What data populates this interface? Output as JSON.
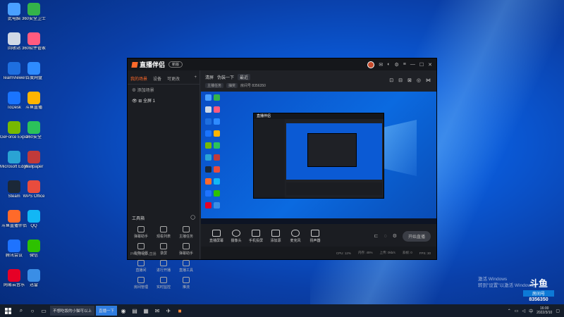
{
  "desktop_icons": [
    {
      "label": "此电脑",
      "color": "#4aa0ff"
    },
    {
      "label": "360安全卫士",
      "color": "#34b34a"
    },
    {
      "label": "回收站",
      "color": "#cfd8e6"
    },
    {
      "label": "360软件管家",
      "color": "#ff5b7f"
    },
    {
      "label": "TeamViewer",
      "color": "#1e6fe0"
    },
    {
      "label": "百度网盘",
      "color": "#2e8bff"
    },
    {
      "label": "ToDesk",
      "color": "#1a74ff"
    },
    {
      "label": "斗鱼直播",
      "color": "#ffb400"
    },
    {
      "label": "GeForce Experience",
      "color": "#76b900"
    },
    {
      "label": "360安全",
      "color": "#2bc25b"
    },
    {
      "label": "Microsoft Edge",
      "color": "#2aa3d4"
    },
    {
      "label": "Wallpaper",
      "color": "#c03a3a"
    },
    {
      "label": "Steam",
      "color": "#1b2838"
    },
    {
      "label": "WPS Office",
      "color": "#e84c3d"
    },
    {
      "label": "斗鱼直播伴侣",
      "color": "#ff6a2a"
    },
    {
      "label": "QQ",
      "color": "#12b7f5"
    },
    {
      "label": "腾讯会议",
      "color": "#1e73ff"
    },
    {
      "label": "微信",
      "color": "#2dc100"
    },
    {
      "label": "网易云音乐",
      "color": "#e60026"
    },
    {
      "label": "迅雷",
      "color": "#3a8ee6"
    }
  ],
  "app": {
    "title": "直播伴侣",
    "version_badge": "新版",
    "sidebar_tabs": [
      "我的场景",
      "设备",
      "可更改"
    ],
    "add_label": "+",
    "scene_add_label": "添加场景",
    "scene_name": "全屏 1",
    "tools_header": "工具箱",
    "tools": [
      "弹幕助手",
      "观看列表",
      "主播任务",
      "礼物设置",
      "录屏",
      "弹幕助手",
      "直播间",
      "进行开播",
      "直播工具",
      "房间管理",
      "实时监控",
      "推流"
    ],
    "status_left": "PK助手进入直播",
    "head_row1": [
      "清屏",
      "伪装一下",
      "最近"
    ],
    "head_row2": [
      "主播任务",
      "抽奖"
    ],
    "room_label": "房间号 8356350",
    "controls": [
      "直播屏幕",
      "摄像头",
      "手机投屏",
      "添加源",
      "麦克风",
      "扬声器"
    ],
    "start_button": "开始直播",
    "status_items": [
      "CPU: 12%",
      "内存: 45%",
      "上传: 0kb/s",
      "丢帧: 0",
      "FPS: 30"
    ]
  },
  "watermark": {
    "line1": "激活 Windows",
    "line2": "转到\"设置\"以激活 Windows。",
    "brand_title": "斗鱼",
    "brand_sub": "房间号",
    "brand_room": "8356350"
  },
  "taskbar": {
    "apps": [
      "不想吃饭的小猫可以上",
      "直播一下"
    ],
    "time": "16:00",
    "date": "2022/3/10",
    "lang": "中"
  }
}
